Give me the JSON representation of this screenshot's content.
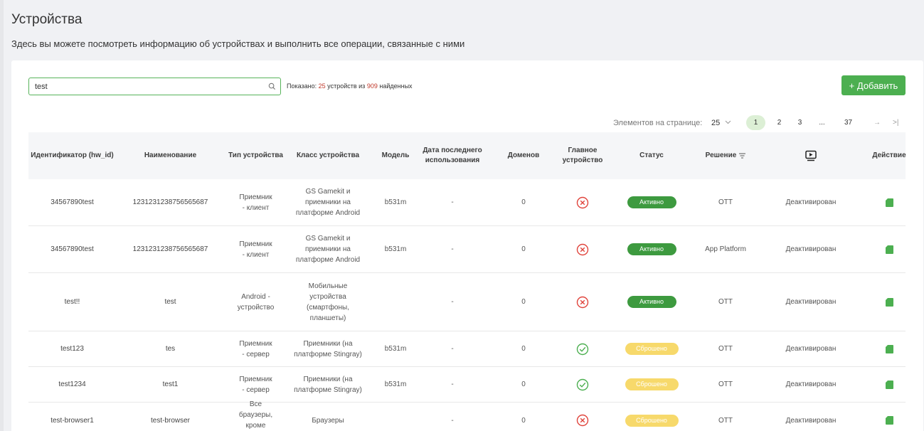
{
  "page": {
    "title": "Устройства",
    "subtitle": "Здесь вы можете посмотреть информацию об устройствах и выполнить все операции, связанные с ними"
  },
  "search": {
    "value": "test",
    "icon": "search-icon"
  },
  "summary": {
    "prefix": "Показано:",
    "shown_count": "25",
    "shown_unit": "устройств",
    "of_word": "из",
    "total_count": "909",
    "total_suffix": "найденных"
  },
  "add_button_label": "+ Добавить",
  "pagination": {
    "per_page_label": "Элементов на странице:",
    "per_page_value": "25",
    "pages": [
      "1",
      "2",
      "3",
      "...",
      "37"
    ],
    "current_page": "1",
    "next_label": "→",
    "last_label": ">|"
  },
  "colors": {
    "accent": "#4caf50",
    "active_badge": "#3d9a3f",
    "reset_badge": "#f7d96b",
    "error_icon": "#e0443c",
    "ok_icon": "#4caf50"
  },
  "table": {
    "headers": {
      "hw_id": "Идентификатор (hw_id)",
      "name": "Наименование",
      "type": "Тип устройства",
      "class": "Класс устройства",
      "model": "Модель",
      "last_used": "Дата последнего использования",
      "domains": "Доменов",
      "main": "Главное устройство",
      "status": "Статус",
      "solution": "Решение",
      "solution_icon": "filter-icon",
      "video_icon": "video-play-icon",
      "action": "Действие"
    },
    "rows": [
      {
        "hw_id": "34567890test",
        "name": "1231231238756565687",
        "type": "Приемник - клиент",
        "class": "GS Gamekit и приемники на платформе Android",
        "model": "b531m",
        "last_used": "-",
        "domains": "0",
        "main": "error",
        "status": "Активно",
        "status_kind": "active",
        "solution": "OTT",
        "video": "Деактивирован",
        "action_icon": "sim-card-icon"
      },
      {
        "hw_id": "34567890test",
        "name": "1231231238756565687",
        "type": "Приемник - клиент",
        "class": "GS Gamekit и приемники на платформе Android",
        "model": "b531m",
        "last_used": "-",
        "domains": "0",
        "main": "error",
        "status": "Активно",
        "status_kind": "active",
        "solution": "App Platform",
        "video": "Деактивирован",
        "action_icon": "sim-card-icon"
      },
      {
        "hw_id": "test!!",
        "name": "test",
        "type": "Android - устройство",
        "class": "Мобильные устройства (смартфоны, планшеты)",
        "model": "",
        "last_used": "-",
        "domains": "0",
        "main": "error",
        "status": "Активно",
        "status_kind": "active",
        "solution": "OTT",
        "video": "Деактивирован",
        "action_icon": "sim-card-icon"
      },
      {
        "hw_id": "test123",
        "name": "tes",
        "type": "Приемник - сервер",
        "class": "Приемники (на платформе Stingray)",
        "model": "b531m",
        "last_used": "-",
        "domains": "0",
        "main": "ok",
        "status": "Сброшено",
        "status_kind": "reset",
        "solution": "OTT",
        "video": "Деактивирован",
        "action_icon": "sim-card-icon"
      },
      {
        "hw_id": "test1234",
        "name": "test1",
        "type": "Приемник - сервер",
        "class": "Приемники (на платформе Stingray)",
        "model": "b531m",
        "last_used": "-",
        "domains": "0",
        "main": "ok",
        "status": "Сброшено",
        "status_kind": "reset",
        "solution": "OTT",
        "video": "Деактивирован",
        "action_icon": "sim-card-icon"
      },
      {
        "hw_id": "test-browser1",
        "name": "test-browser",
        "type": "Все браузеры, кроме Safari",
        "class": "Браузеры",
        "model": "",
        "last_used": "-",
        "domains": "0",
        "main": "error",
        "status": "Сброшено",
        "status_kind": "reset",
        "solution": "OTT",
        "video": "Деактивирован",
        "action_icon": "sim-card-icon"
      }
    ]
  }
}
